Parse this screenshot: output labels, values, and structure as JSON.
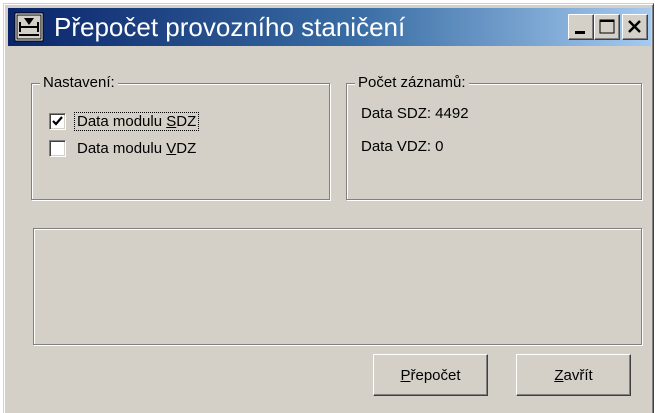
{
  "window": {
    "title": "Přepočet provozního staničení",
    "controls": {
      "minimize_icon": "minimize-icon",
      "maximize_icon": "maximize-icon",
      "close_icon": "close-icon"
    }
  },
  "settings": {
    "legend": "Nastavení:",
    "options": [
      {
        "label_before": "Data modulu ",
        "accel": "S",
        "label_after": "DZ",
        "checked": true
      },
      {
        "label_before": "Data modulu ",
        "accel": "V",
        "label_after": "DZ",
        "checked": false
      }
    ]
  },
  "counts": {
    "legend": "Počet záznamů:",
    "sdz": "Data SDZ: 4492",
    "vdz": "Data VDZ: 0"
  },
  "buttons": {
    "recalc": {
      "accel": "P",
      "rest": "řepočet"
    },
    "close": {
      "accel": "Z",
      "rest": "avřít"
    }
  }
}
